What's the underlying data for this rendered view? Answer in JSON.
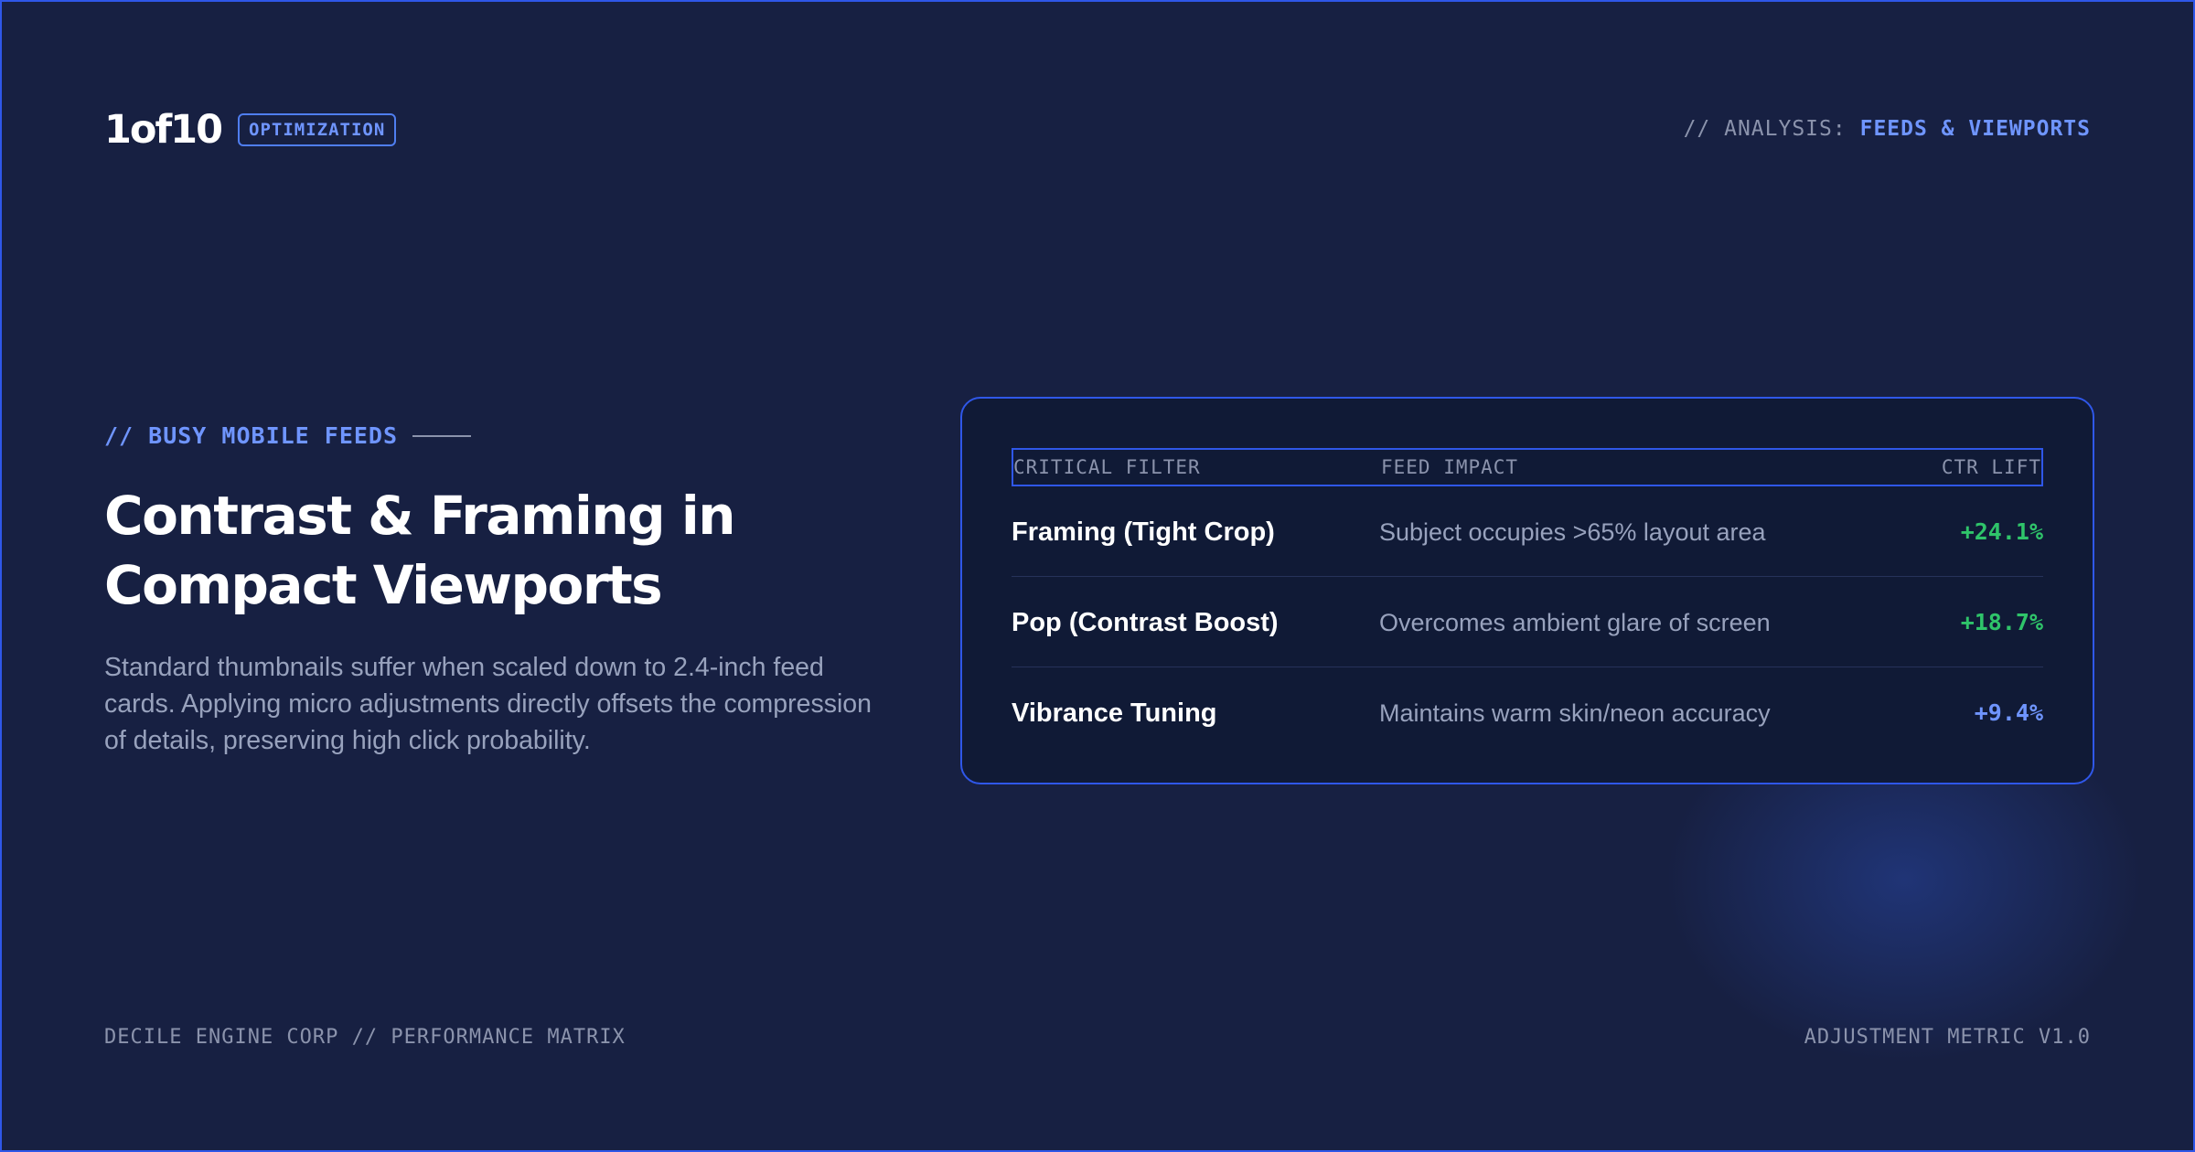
{
  "header": {
    "logo": "1of10",
    "badge": "OPTIMIZATION",
    "analysis_prefix": "// ANALYSIS:",
    "analysis_topic": "FEEDS & VIEWPORTS"
  },
  "section": {
    "kicker": "// BUSY MOBILE FEEDS",
    "headline_line1": "Contrast & Framing in",
    "headline_line2": "Compact Viewports",
    "body": "Standard thumbnails suffer when scaled down to 2.4-inch feed cards. Applying micro adjustments directly offsets the compression of details, preserving high click probability."
  },
  "table": {
    "columns": {
      "filter": "CRITICAL FILTER",
      "impact": "FEED IMPACT",
      "lift": "CTR LIFT"
    },
    "rows": [
      {
        "filter": "Framing (Tight Crop)",
        "impact": "Subject occupies >65% layout area",
        "lift": "+24.1%"
      },
      {
        "filter": "Pop (Contrast Boost)",
        "impact": "Overcomes ambient glare of screen",
        "lift": "+18.7%"
      },
      {
        "filter": "Vibrance Tuning",
        "impact": "Maintains warm skin/neon accuracy",
        "lift": "+9.4%"
      }
    ]
  },
  "footer": {
    "left": "DECILE ENGINE CORP // PERFORMANCE MATRIX",
    "right": "ADJUSTMENT METRIC V1.0"
  },
  "colors": {
    "background": "#172042",
    "accent_blue": "#6f95ff",
    "border_blue": "#2f57e8",
    "lift_green": "#2fc46a",
    "muted_text": "#98a2bd"
  }
}
